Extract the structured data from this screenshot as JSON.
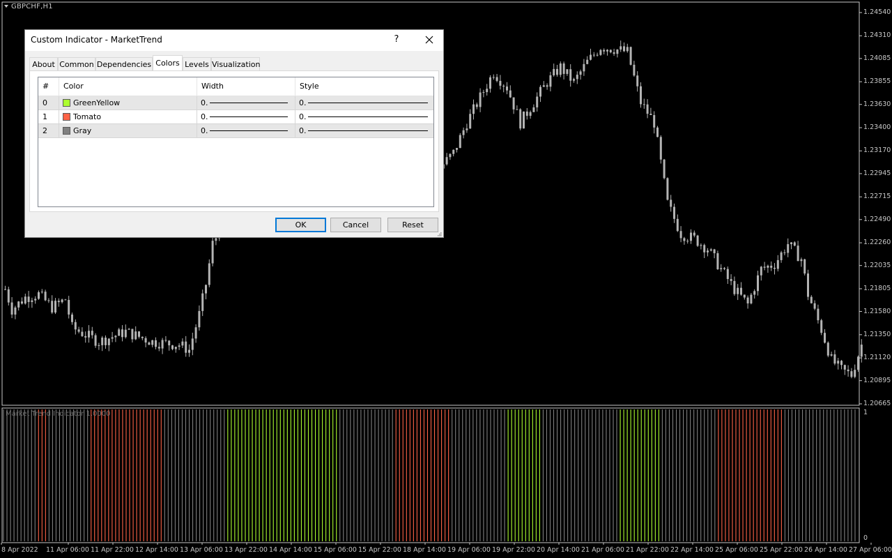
{
  "chart": {
    "symbol_label": "GBPCHF,H1",
    "indicator_label": "Market Trend Indicator 1.0000",
    "price_ticks": [
      "1.24540",
      "1.24310",
      "1.24085",
      "1.23855",
      "1.23630",
      "1.23400",
      "1.23170",
      "1.22945",
      "1.22715",
      "1.22490",
      "1.22260",
      "1.22035",
      "1.21805",
      "1.21580",
      "1.21350",
      "1.21120",
      "1.20895",
      "1.20665"
    ],
    "indicator_ticks": [
      "1",
      "0"
    ],
    "time_ticks": [
      "8 Apr 2022",
      "11 Apr 06:00",
      "11 Apr 22:00",
      "12 Apr 14:00",
      "13 Apr 06:00",
      "13 Apr 22:00",
      "14 Apr 14:00",
      "15 Apr 06:00",
      "15 Apr 22:00",
      "18 Apr 14:00",
      "19 Apr 06:00",
      "19 Apr 22:00",
      "20 Apr 14:00",
      "21 Apr 06:00",
      "21 Apr 22:00",
      "22 Apr 14:00",
      "25 Apr 06:00",
      "25 Apr 22:00",
      "26 Apr 14:00",
      "27 Apr 06:00"
    ],
    "colors": {
      "background": "#000000",
      "candle": "#b4b4b4",
      "trend_up": "#adff2f",
      "trend_down": "#ff6347",
      "trend_flat": "#808080"
    },
    "trend_segments": [
      {
        "state": "flat",
        "bars": 10
      },
      {
        "state": "down",
        "bars": 3
      },
      {
        "state": "flat",
        "bars": 12
      },
      {
        "state": "down",
        "bars": 21
      },
      {
        "state": "flat",
        "bars": 18
      },
      {
        "state": "up",
        "bars": 32
      },
      {
        "state": "flat",
        "bars": 16
      },
      {
        "state": "down",
        "bars": 16
      },
      {
        "state": "flat",
        "bars": 16
      },
      {
        "state": "up",
        "bars": 10
      },
      {
        "state": "flat",
        "bars": 22
      },
      {
        "state": "up",
        "bars": 12
      },
      {
        "state": "flat",
        "bars": 16
      },
      {
        "state": "down",
        "bars": 19
      },
      {
        "state": "flat",
        "bars": 21
      }
    ],
    "price_path_keypoints": [
      [
        0,
        1.218
      ],
      [
        2,
        1.216
      ],
      [
        6,
        1.2172
      ],
      [
        10,
        1.2175
      ],
      [
        14,
        1.2162
      ],
      [
        18,
        1.217
      ],
      [
        20,
        1.2142
      ],
      [
        28,
        1.2128
      ],
      [
        36,
        1.2138
      ],
      [
        44,
        1.2128
      ],
      [
        52,
        1.2125
      ],
      [
        55,
        1.212
      ],
      [
        58,
        1.2155
      ],
      [
        60,
        1.2185
      ],
      [
        62,
        1.2225
      ],
      [
        66,
        1.225
      ],
      [
        72,
        1.2275
      ],
      [
        78,
        1.2285
      ],
      [
        84,
        1.227
      ],
      [
        90,
        1.2275
      ],
      [
        96,
        1.229
      ],
      [
        102,
        1.228
      ],
      [
        108,
        1.2295
      ],
      [
        114,
        1.23
      ],
      [
        120,
        1.2305
      ],
      [
        126,
        1.2295
      ],
      [
        130,
        1.23
      ],
      [
        134,
        1.2315
      ],
      [
        138,
        1.2345
      ],
      [
        142,
        1.237
      ],
      [
        146,
        1.2395
      ],
      [
        150,
        1.238
      ],
      [
        154,
        1.2345
      ],
      [
        158,
        1.2365
      ],
      [
        162,
        1.2385
      ],
      [
        166,
        1.24
      ],
      [
        170,
        1.2385
      ],
      [
        174,
        1.2405
      ],
      [
        178,
        1.242
      ],
      [
        182,
        1.2418
      ],
      [
        186,
        1.2415
      ],
      [
        190,
        1.2365
      ],
      [
        194,
        1.2345
      ],
      [
        198,
        1.2265
      ],
      [
        202,
        1.2235
      ],
      [
        206,
        1.223
      ],
      [
        210,
        1.222
      ],
      [
        214,
        1.22
      ],
      [
        218,
        1.218
      ],
      [
        222,
        1.2165
      ],
      [
        226,
        1.22
      ],
      [
        230,
        1.2205
      ],
      [
        234,
        1.2225
      ],
      [
        238,
        1.221
      ],
      [
        240,
        1.2175
      ],
      [
        244,
        1.214
      ],
      [
        247,
        1.211
      ],
      [
        250,
        1.21
      ],
      [
        253,
        1.2095
      ],
      [
        256,
        1.2125
      ]
    ]
  },
  "dialog": {
    "title": "Custom Indicator - MarketTrend",
    "help": "?",
    "tabs": [
      "About",
      "Common",
      "Dependencies",
      "Colors",
      "Levels",
      "Visualization"
    ],
    "active_tab": "Colors",
    "columns": [
      "#",
      "Color",
      "Width",
      "Style"
    ],
    "rows": [
      {
        "index": "0",
        "color_name": "GreenYellow",
        "swatch": "#adff2f",
        "width": "0.",
        "style": "0."
      },
      {
        "index": "1",
        "color_name": "Tomato",
        "swatch": "#ff6347",
        "width": "0.",
        "style": "0."
      },
      {
        "index": "2",
        "color_name": "Gray",
        "swatch": "#808080",
        "width": "0.",
        "style": "0."
      }
    ],
    "buttons": {
      "ok": "OK",
      "cancel": "Cancel",
      "reset": "Reset"
    }
  }
}
